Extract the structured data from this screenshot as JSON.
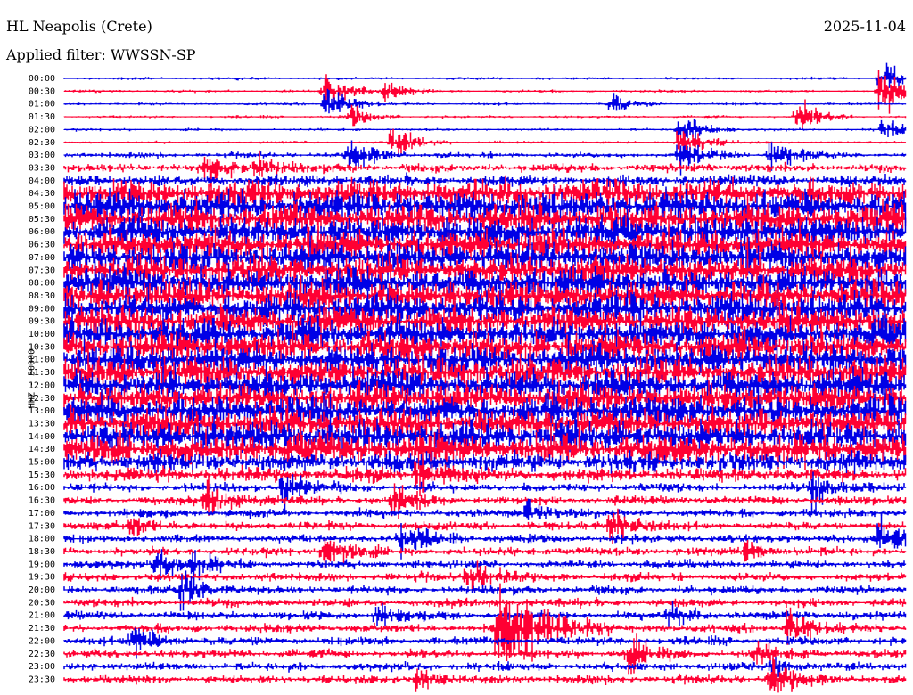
{
  "header": {
    "station": "HL Neapolis (Crete)",
    "date": "2025-11-04",
    "filter": "Applied filter: WWSSN-SP"
  },
  "chart_data": {
    "type": "helicorder",
    "title": "HL Neapolis (Crete)",
    "ylabel": "HHZ - 50000",
    "rows": [
      "00:00",
      "00:30",
      "01:00",
      "01:30",
      "02:00",
      "02:30",
      "03:00",
      "03:30",
      "04:00",
      "04:30",
      "05:00",
      "05:30",
      "06:00",
      "06:30",
      "07:00",
      "07:30",
      "08:00",
      "08:30",
      "09:00",
      "09:30",
      "10:00",
      "10:30",
      "11:00",
      "11:30",
      "12:00",
      "12:30",
      "13:00",
      "13:30",
      "14:00",
      "14:30",
      "15:00",
      "15:30",
      "16:00",
      "16:30",
      "17:00",
      "17:30",
      "18:00",
      "18:30",
      "19:00",
      "19:30",
      "20:00",
      "20:30",
      "21:00",
      "21:30",
      "22:00",
      "22:30",
      "23:00",
      "23:30"
    ],
    "series_colors": [
      "#0000e6",
      "#ff0033"
    ],
    "noise_level": [
      1,
      1,
      1,
      1,
      1,
      1,
      2,
      3,
      4,
      10,
      11,
      11,
      11,
      11,
      11,
      11,
      11,
      11,
      11,
      11,
      11,
      11,
      11,
      11,
      11,
      11,
      11,
      11,
      11,
      11,
      7,
      5,
      3,
      3,
      3,
      3,
      3,
      3,
      3,
      3,
      3,
      3,
      3,
      3,
      3,
      3,
      3,
      3
    ],
    "events": [
      {
        "row": 0,
        "pos": 0.97,
        "amp": 3
      },
      {
        "row": 1,
        "pos": 0.31,
        "amp": 3
      },
      {
        "row": 1,
        "pos": 0.38,
        "amp": 2
      },
      {
        "row": 1,
        "pos": 0.97,
        "amp": 4
      },
      {
        "row": 2,
        "pos": 0.31,
        "amp": 3
      },
      {
        "row": 2,
        "pos": 0.65,
        "amp": 2
      },
      {
        "row": 3,
        "pos": 0.34,
        "amp": 2
      },
      {
        "row": 3,
        "pos": 0.87,
        "amp": 3
      },
      {
        "row": 4,
        "pos": 0.73,
        "amp": 3
      },
      {
        "row": 4,
        "pos": 0.97,
        "amp": 2
      },
      {
        "row": 5,
        "pos": 0.39,
        "amp": 3
      },
      {
        "row": 5,
        "pos": 0.73,
        "amp": 3
      },
      {
        "row": 6,
        "pos": 0.34,
        "amp": 3
      },
      {
        "row": 6,
        "pos": 0.73,
        "amp": 3
      },
      {
        "row": 6,
        "pos": 0.84,
        "amp": 3
      },
      {
        "row": 7,
        "pos": 0.17,
        "amp": 3
      },
      {
        "row": 7,
        "pos": 0.23,
        "amp": 2
      },
      {
        "row": 31,
        "pos": 0.42,
        "amp": 3
      },
      {
        "row": 32,
        "pos": 0.26,
        "amp": 3
      },
      {
        "row": 32,
        "pos": 0.89,
        "amp": 3
      },
      {
        "row": 33,
        "pos": 0.17,
        "amp": 3
      },
      {
        "row": 33,
        "pos": 0.39,
        "amp": 3
      },
      {
        "row": 34,
        "pos": 0.55,
        "amp": 2
      },
      {
        "row": 35,
        "pos": 0.08,
        "amp": 2
      },
      {
        "row": 35,
        "pos": 0.65,
        "amp": 3
      },
      {
        "row": 36,
        "pos": 0.4,
        "amp": 3
      },
      {
        "row": 36,
        "pos": 0.97,
        "amp": 3
      },
      {
        "row": 37,
        "pos": 0.31,
        "amp": 3
      },
      {
        "row": 37,
        "pos": 0.81,
        "amp": 2
      },
      {
        "row": 38,
        "pos": 0.11,
        "amp": 3
      },
      {
        "row": 38,
        "pos": 0.15,
        "amp": 2
      },
      {
        "row": 39,
        "pos": 0.48,
        "amp": 3
      },
      {
        "row": 40,
        "pos": 0.14,
        "amp": 3
      },
      {
        "row": 42,
        "pos": 0.37,
        "amp": 2
      },
      {
        "row": 42,
        "pos": 0.72,
        "amp": 2
      },
      {
        "row": 43,
        "pos": 0.52,
        "amp": 8
      },
      {
        "row": 43,
        "pos": 0.86,
        "amp": 3
      },
      {
        "row": 44,
        "pos": 0.08,
        "amp": 3
      },
      {
        "row": 45,
        "pos": 0.67,
        "amp": 3
      },
      {
        "row": 45,
        "pos": 0.82,
        "amp": 2
      },
      {
        "row": 46,
        "pos": 0.84,
        "amp": 2
      },
      {
        "row": 47,
        "pos": 0.42,
        "amp": 2
      },
      {
        "row": 47,
        "pos": 0.84,
        "amp": 3
      }
    ]
  }
}
